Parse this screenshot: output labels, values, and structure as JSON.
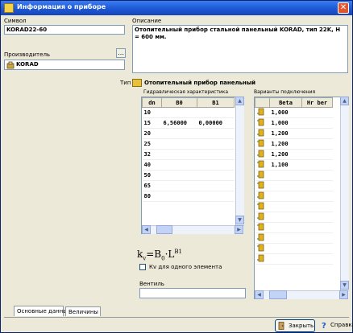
{
  "window": {
    "title": "Информация о приборе",
    "close_glyph": "✕"
  },
  "left": {
    "symbol_label": "Символ",
    "symbol_value": "KORAD22-60",
    "manufacturer_label": "Производитель",
    "manufacturer_value": "KORAD",
    "pick_glyph": "…"
  },
  "description": {
    "label": "Описание",
    "text": "Отопительный прибор стальной панельный KORAD, тип 22K, H = 600 мм."
  },
  "type": {
    "label": "Тип",
    "value": "Отопительный прибор панельный",
    "swatch_color": "#e8c03c"
  },
  "hydraulics": {
    "title": "Гидравлическая характеристика",
    "columns": [
      "dn",
      "B0",
      "B1"
    ],
    "rows": [
      [
        "10",
        "",
        ""
      ],
      [
        "15",
        "6,56000",
        "0,00000"
      ],
      [
        "20",
        "",
        ""
      ],
      [
        "25",
        "",
        ""
      ],
      [
        "32",
        "",
        ""
      ],
      [
        "40",
        "",
        ""
      ],
      [
        "50",
        "",
        ""
      ],
      [
        "65",
        "",
        ""
      ],
      [
        "80",
        "",
        ""
      ]
    ],
    "formula": {
      "k": "k",
      "v": "v",
      "eq": "=B",
      "b0": "0",
      "dot": "·",
      "l": "L",
      "b1": "B1"
    },
    "checkbox_label": "Кv для одного элемента",
    "valve_label": "Вентиль",
    "valve_value": ""
  },
  "variants": {
    "title": "Варианты подключения",
    "columns": [
      "",
      "Beta",
      "Hr ber"
    ],
    "rows": [
      {
        "icon_color": "#e2b21c",
        "beta": "1,000",
        "hr": ""
      },
      {
        "icon_color": "#e2b21c",
        "beta": "1,000",
        "hr": ""
      },
      {
        "icon_color": "#e2b21c",
        "beta": "1,200",
        "hr": ""
      },
      {
        "icon_color": "#e2b21c",
        "beta": "1,200",
        "hr": ""
      },
      {
        "icon_color": "#e2b21c",
        "beta": "1,200",
        "hr": ""
      },
      {
        "icon_color": "#e2b21c",
        "beta": "1,100",
        "hr": ""
      },
      {
        "icon_color": "#e2b21c",
        "beta": "",
        "hr": ""
      },
      {
        "icon_color": "#e2b21c",
        "beta": "",
        "hr": ""
      },
      {
        "icon_color": "#e2b21c",
        "beta": "",
        "hr": ""
      },
      {
        "icon_color": "#e2b21c",
        "beta": "",
        "hr": ""
      },
      {
        "icon_color": "#e2b21c",
        "beta": "",
        "hr": ""
      },
      {
        "icon_color": "#e2b21c",
        "beta": "",
        "hr": ""
      },
      {
        "icon_color": "#e2b21c",
        "beta": "",
        "hr": ""
      },
      {
        "icon_color": "#e2b21c",
        "beta": "",
        "hr": ""
      },
      {
        "icon_color": "#e2b21c",
        "beta": "",
        "hr": ""
      }
    ]
  },
  "tabs": [
    {
      "label": "Основные данные",
      "active": true
    },
    {
      "label": "Величины",
      "active": false
    }
  ],
  "footer": {
    "close_label": "Закрыть",
    "help_label": "Справка"
  }
}
